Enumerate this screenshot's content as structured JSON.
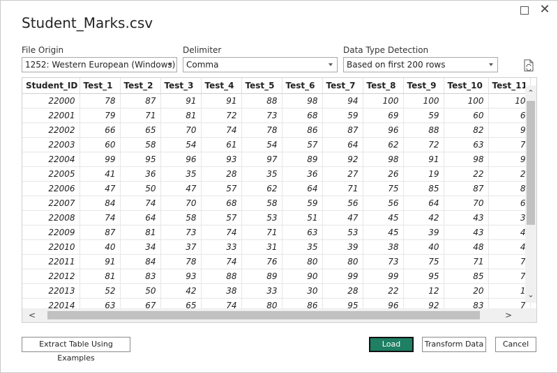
{
  "window": {
    "title": "Student_Marks.csv",
    "maximize_icon": "maximize-icon",
    "close_glyph": "✕"
  },
  "options": {
    "file_origin": {
      "label": "File Origin",
      "value": "1252: Western European (Windows)"
    },
    "delimiter": {
      "label": "Delimiter",
      "value": "Comma"
    },
    "data_type_detection": {
      "label": "Data Type Detection",
      "value": "Based on first 200 rows"
    },
    "refresh_icon": "refresh-document-icon"
  },
  "table": {
    "columns": [
      "Student_ID",
      "Test_1",
      "Test_2",
      "Test_3",
      "Test_4",
      "Test_5",
      "Test_6",
      "Test_7",
      "Test_8",
      "Test_9",
      "Test_10",
      "Test_11"
    ],
    "rows": [
      [
        "22000",
        "78",
        "87",
        "91",
        "91",
        "88",
        "98",
        "94",
        "100",
        "100",
        "100",
        "10"
      ],
      [
        "22001",
        "79",
        "71",
        "81",
        "72",
        "73",
        "68",
        "59",
        "69",
        "59",
        "60",
        "6"
      ],
      [
        "22002",
        "66",
        "65",
        "70",
        "74",
        "78",
        "86",
        "87",
        "96",
        "88",
        "82",
        "9"
      ],
      [
        "22003",
        "60",
        "58",
        "54",
        "61",
        "54",
        "57",
        "64",
        "62",
        "72",
        "63",
        "7"
      ],
      [
        "22004",
        "99",
        "95",
        "96",
        "93",
        "97",
        "89",
        "92",
        "98",
        "91",
        "98",
        "9"
      ],
      [
        "22005",
        "41",
        "36",
        "35",
        "28",
        "35",
        "36",
        "27",
        "26",
        "19",
        "22",
        "2"
      ],
      [
        "22006",
        "47",
        "50",
        "47",
        "57",
        "62",
        "64",
        "71",
        "75",
        "85",
        "87",
        "8"
      ],
      [
        "22007",
        "84",
        "74",
        "70",
        "68",
        "58",
        "59",
        "56",
        "56",
        "64",
        "70",
        "6"
      ],
      [
        "22008",
        "74",
        "64",
        "58",
        "57",
        "53",
        "51",
        "47",
        "45",
        "42",
        "43",
        "3"
      ],
      [
        "22009",
        "87",
        "81",
        "73",
        "74",
        "71",
        "63",
        "53",
        "45",
        "39",
        "43",
        "4"
      ],
      [
        "22010",
        "40",
        "34",
        "37",
        "33",
        "31",
        "35",
        "39",
        "38",
        "40",
        "48",
        "4"
      ],
      [
        "22011",
        "91",
        "84",
        "78",
        "74",
        "76",
        "80",
        "80",
        "73",
        "75",
        "71",
        "7"
      ],
      [
        "22012",
        "81",
        "83",
        "93",
        "88",
        "89",
        "90",
        "99",
        "99",
        "95",
        "85",
        "7"
      ],
      [
        "22013",
        "52",
        "50",
        "42",
        "38",
        "33",
        "30",
        "28",
        "22",
        "12",
        "20",
        "1"
      ],
      [
        "22014",
        "63",
        "67",
        "65",
        "74",
        "80",
        "86",
        "95",
        "96",
        "92",
        "83",
        "7"
      ]
    ]
  },
  "buttons": {
    "extract": "Extract Table Using Examples",
    "load": "Load",
    "transform": "Transform Data",
    "cancel": "Cancel"
  },
  "colors": {
    "load_button": "#1e7f63"
  }
}
